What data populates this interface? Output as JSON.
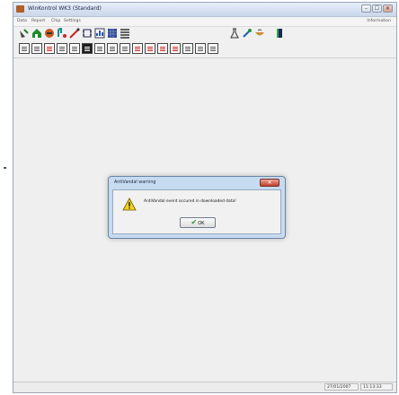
{
  "window": {
    "title": "WinKontrol WK3 (Standard)",
    "controls": {
      "minimize": "–",
      "maximize": "☐",
      "close": "✕"
    }
  },
  "menu": {
    "items": [
      "Data",
      "Report",
      "Chip",
      "Settings"
    ],
    "info": "Information"
  },
  "toolbar1": {
    "icons": [
      "satellite-dish-icon",
      "house-icon",
      "crest-icon",
      "wrench-icon",
      "line-tool-icon",
      "chip-icon",
      "chart-icon",
      "grid-icon",
      "list-icon",
      "flask-icon",
      "tools-icon",
      "bowl-icon",
      "exit-door-icon"
    ]
  },
  "toolbar2": {
    "icons": [
      "document-icon",
      "document-list-icon",
      "document-chart-icon",
      "document-arrow-icon",
      "document-photo-icon",
      "document-dark-icon",
      "document-dark-2-icon",
      "document-page-icon",
      "document-search-icon",
      "document-red-icon",
      "document-red-2-icon",
      "document-red-3-icon",
      "document-red-4-icon",
      "document-blue-icon",
      "document-green-icon",
      "document-print-icon"
    ]
  },
  "dialog": {
    "title": "AntiVandal warning",
    "message": "AntiVandal event occured in downloaded data!",
    "ok_label": "OK",
    "close_label": "✕"
  },
  "status": {
    "date": "27/01/2007",
    "time": "11:13:33"
  },
  "colors": {
    "titlebar": "#cad7ea",
    "dialog_frame": "#c6daf0",
    "close_red": "#c2402c",
    "ok_check": "#2a9a2a"
  }
}
